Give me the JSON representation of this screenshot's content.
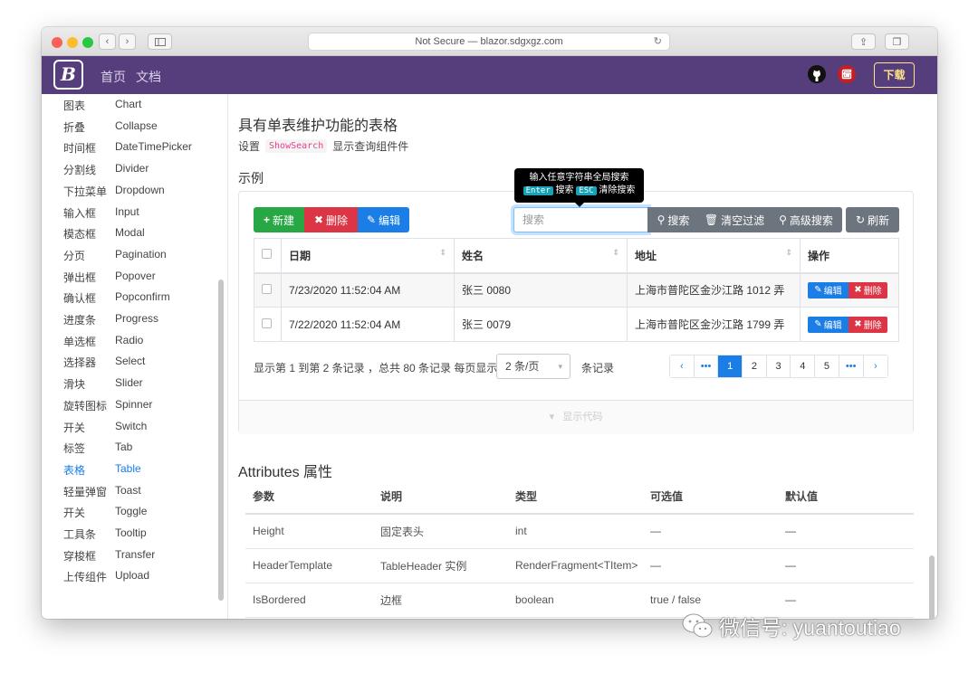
{
  "browser": {
    "url": "Not Secure — blazor.sdgxgz.com",
    "lights": [
      "#fc5f57",
      "#fdbc2e",
      "#28c840"
    ]
  },
  "navbar": {
    "brand": "B",
    "links": [
      "首页",
      "文档"
    ],
    "download": "下载",
    "bg": "#563d7c"
  },
  "sidebar": {
    "items": [
      {
        "cn": "图表",
        "en": "Chart"
      },
      {
        "cn": "折叠",
        "en": "Collapse"
      },
      {
        "cn": "时间框",
        "en": "DateTimePicker"
      },
      {
        "cn": "分割线",
        "en": "Divider"
      },
      {
        "cn": "下拉菜单",
        "en": "Dropdown"
      },
      {
        "cn": "输入框",
        "en": "Input"
      },
      {
        "cn": "模态框",
        "en": "Modal"
      },
      {
        "cn": "分页",
        "en": "Pagination"
      },
      {
        "cn": "弹出框",
        "en": "Popover"
      },
      {
        "cn": "确认框",
        "en": "Popconfirm"
      },
      {
        "cn": "进度条",
        "en": "Progress"
      },
      {
        "cn": "单选框",
        "en": "Radio"
      },
      {
        "cn": "选择器",
        "en": "Select"
      },
      {
        "cn": "滑块",
        "en": "Slider"
      },
      {
        "cn": "旋转图标",
        "en": "Spinner"
      },
      {
        "cn": "开关",
        "en": "Switch"
      },
      {
        "cn": "标签",
        "en": "Tab"
      },
      {
        "cn": "表格",
        "en": "Table"
      },
      {
        "cn": "轻量弹窗",
        "en": "Toast"
      },
      {
        "cn": "开关",
        "en": "Toggle"
      },
      {
        "cn": "工具条",
        "en": "Tooltip"
      },
      {
        "cn": "穿梭框",
        "en": "Transfer"
      },
      {
        "cn": "上传组件",
        "en": "Upload"
      }
    ],
    "active_index": 17
  },
  "main": {
    "title": "具有单表维护功能的表格",
    "desc_prefix": "设置",
    "desc_code": "ShowSearch",
    "desc_suffix": "显示查询组件件",
    "section": "示例",
    "toolbar": {
      "new": "新建",
      "delete": "删除",
      "edit": "编辑",
      "search_placeholder": "搜索",
      "search": "搜索",
      "clear": "清空过滤",
      "advanced": "高级搜索",
      "refresh": "刷新"
    },
    "tooltip": {
      "line1": "输入任意字符串全局搜索",
      "key1": "Enter",
      "text1": "搜索",
      "key2": "ESC",
      "text2": "清除搜索"
    },
    "table": {
      "headers": [
        "日期",
        "姓名",
        "地址",
        "操作"
      ],
      "rows": [
        {
          "date": "7/23/2020 11:52:04 AM",
          "name": "张三 0080",
          "address": "上海市普陀区金沙江路 1012 弄"
        },
        {
          "date": "7/22/2020 11:52:04 AM",
          "name": "张三 0079",
          "address": "上海市普陀区金沙江路 1799 弄"
        }
      ],
      "row_edit": "编辑",
      "row_delete": "删除"
    },
    "pagination": {
      "summary": "显示第 1 到第 2 条记录 ，总共 80 条记录 每页显示",
      "page_size": "2 条/页",
      "unit": "条记录",
      "pages": [
        "1",
        "2",
        "3",
        "4",
        "5"
      ],
      "active_page": "1"
    },
    "show_code": "显示代码"
  },
  "attributes": {
    "title": "Attributes 属性",
    "headers": [
      "参数",
      "说明",
      "类型",
      "可选值",
      "默认值"
    ],
    "rows": [
      [
        "Height",
        "固定表头",
        "int",
        "—",
        "—"
      ],
      [
        "HeaderTemplate",
        "TableHeader 实例",
        "RenderFragment<TItem>",
        "—",
        "—"
      ],
      [
        "IsBordered",
        "边框",
        "boolean",
        "true / false",
        "—"
      ]
    ]
  },
  "watermark": "微信号: yuantoutiao",
  "colors": {
    "success": "#28a745",
    "danger": "#dc3545",
    "primary": "#1b7ee6",
    "secondary": "#6c757d"
  }
}
